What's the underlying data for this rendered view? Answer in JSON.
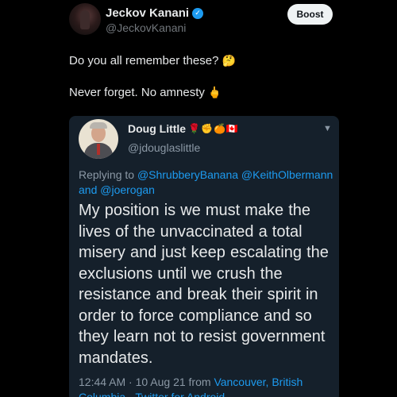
{
  "author": {
    "name": "Jeckov Kanani",
    "handle": "@JeckovKanani",
    "verified_mark": "✓"
  },
  "boost_label": "Boost",
  "tweet": {
    "line1": "Do you all remember these?",
    "line1_emoji": "🤔",
    "line2": "Never forget. No amnesty",
    "line2_emoji": "🖕"
  },
  "quote": {
    "name": "Doug Little",
    "name_emojis": "🌹✊🍊🇨🇦",
    "handle": "@jdouglaslittle",
    "reply_prefix": "Replying to",
    "reply_user1": "@ShrubberyBanana",
    "reply_user2": "@KeithOlbermann",
    "reply_and": "and",
    "reply_user3": "@joerogan",
    "body": "My position is we must make the lives of the unvaccinated a total misery and just keep escalating the exclusions until we crush the resistance and break their spirit in order to force compliance and so they learn not to resist government mandates.",
    "time": "12:44 AM · 10 Aug 21 from",
    "location": "Vancouver, British Columbia",
    "separator": "·",
    "source": "Twitter for Android"
  },
  "icons": {
    "verified": "verified-badge-icon",
    "chevron": "chevron-down-icon"
  },
  "colors": {
    "background": "#000000",
    "card": "#15202b",
    "link": "#1d9bf0",
    "muted": "#8b98a5"
  }
}
